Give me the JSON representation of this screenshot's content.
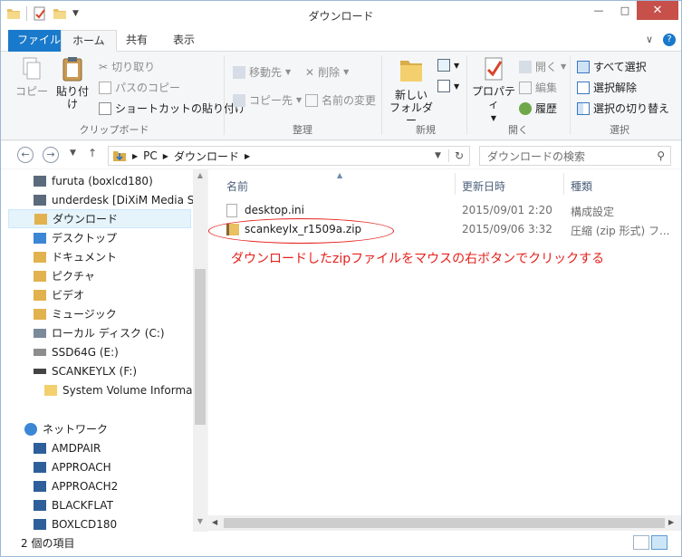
{
  "window": {
    "title": "ダウンロード",
    "minimize": "—",
    "maximize": "□",
    "close": "✕"
  },
  "ribbon_tabs": [
    "ファイル",
    "ホーム",
    "共有",
    "表示"
  ],
  "ribbon_right": {
    "collapse": "∨",
    "help": "?"
  },
  "ribbon": {
    "clipboard": {
      "label": "クリップボード",
      "copy": "コピー",
      "paste": "貼り付け",
      "cut": "切り取り",
      "copy_path": "パスのコピー",
      "paste_shortcut": "ショートカットの貼り付け"
    },
    "organize": {
      "label": "整理",
      "move_to": "移動先",
      "copy_to": "コピー先",
      "delete": "削除",
      "rename": "名前の変更"
    },
    "new": {
      "label": "新規",
      "new_folder_1": "新しい",
      "new_folder_2": "フォルダー"
    },
    "open": {
      "label": "開く",
      "properties": "プロパティ",
      "open": "開く",
      "edit": "編集",
      "history": "履歴"
    },
    "select": {
      "label": "選択",
      "select_all": "すべて選択",
      "select_none": "選択解除",
      "invert": "選択の切り替え"
    }
  },
  "address": {
    "segments": [
      "PC",
      "ダウンロード"
    ],
    "search_placeholder": "ダウンロードの検索"
  },
  "nav_tree": [
    "furuta (boxlcd180)",
    "underdesk [DiXiM Media S",
    "ダウンロード",
    "デスクトップ",
    "ドキュメント",
    "ピクチャ",
    "ビデオ",
    "ミュージック",
    "ローカル ディスク (C:)",
    "SSD64G (E:)",
    "SCANKEYLX (F:)",
    "System Volume Informa",
    "ネットワーク",
    "AMDPAIR",
    "APPROACH",
    "APPROACH2",
    "BLACKFLAT",
    "BOXLCD180"
  ],
  "columns": {
    "name": "名前",
    "date": "更新日時",
    "type": "種類"
  },
  "files": [
    {
      "name": "desktop.ini",
      "date": "2015/09/01 2:20",
      "type": "構成設定"
    },
    {
      "name": "scankeylx_r1509a.zip",
      "date": "2015/09/06 3:32",
      "type": "圧縮 (zip 形式) フ..."
    }
  ],
  "annotation": "ダウンロードしたzipファイルをマウスの右ボタンでクリックする",
  "status": "2 個の項目",
  "colors": {
    "accent": "#1979ca",
    "annotation": "#e5201b",
    "close": "#c7504a"
  }
}
